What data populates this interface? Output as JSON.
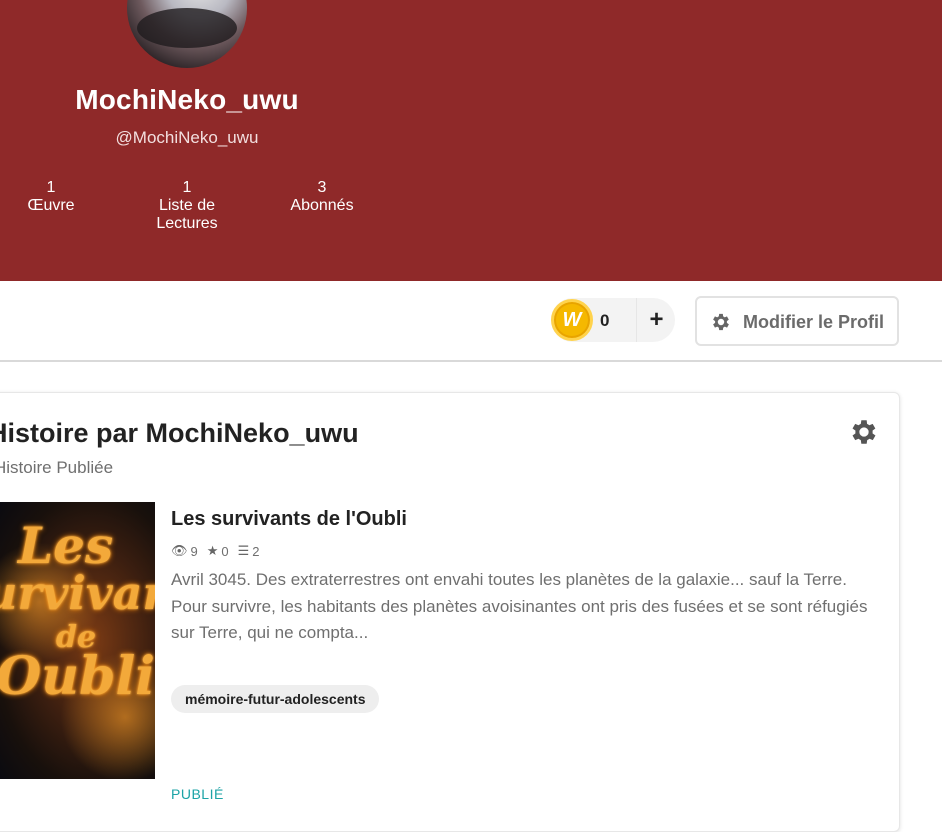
{
  "profile": {
    "username": "MochiNeko_uwu",
    "handle": "@MochiNeko_uwu",
    "stats": [
      {
        "value": "1",
        "label_line1": "Œuvre",
        "label_line2": ""
      },
      {
        "value": "1",
        "label_line1": "Liste de",
        "label_line2": "Lectures"
      },
      {
        "value": "3",
        "label_line1": "Abonnés",
        "label_line2": ""
      }
    ],
    "banner_color": "#8f2929"
  },
  "toolbar": {
    "coin_icon": "W",
    "coin_count": "0",
    "plus_label": "+",
    "edit_label": "Modifier le Profil"
  },
  "section": {
    "title": "Histoire par MochiNeko_uwu",
    "subtitle": "Histoire Publiée"
  },
  "story": {
    "title": "Les survivants de l'Oubli",
    "reads": "9",
    "votes": "0",
    "parts": "2",
    "description": "Avril 3045. Des extraterrestres ont envahi toutes les planètes de la galaxie... sauf la Terre. Pour survivre, les habitants des planètes avoisinantes ont pris des fusées et se sont réfugiés sur Terre, qui ne compta...",
    "tag": "mémoire-futur-adolescents",
    "status": "PUBLIÉ",
    "cover_text": [
      "Les",
      "urvivan",
      "de",
      "Oubli"
    ]
  },
  "colors": {
    "accent_status": "#1ca3a6",
    "coin": "#f5b800"
  }
}
